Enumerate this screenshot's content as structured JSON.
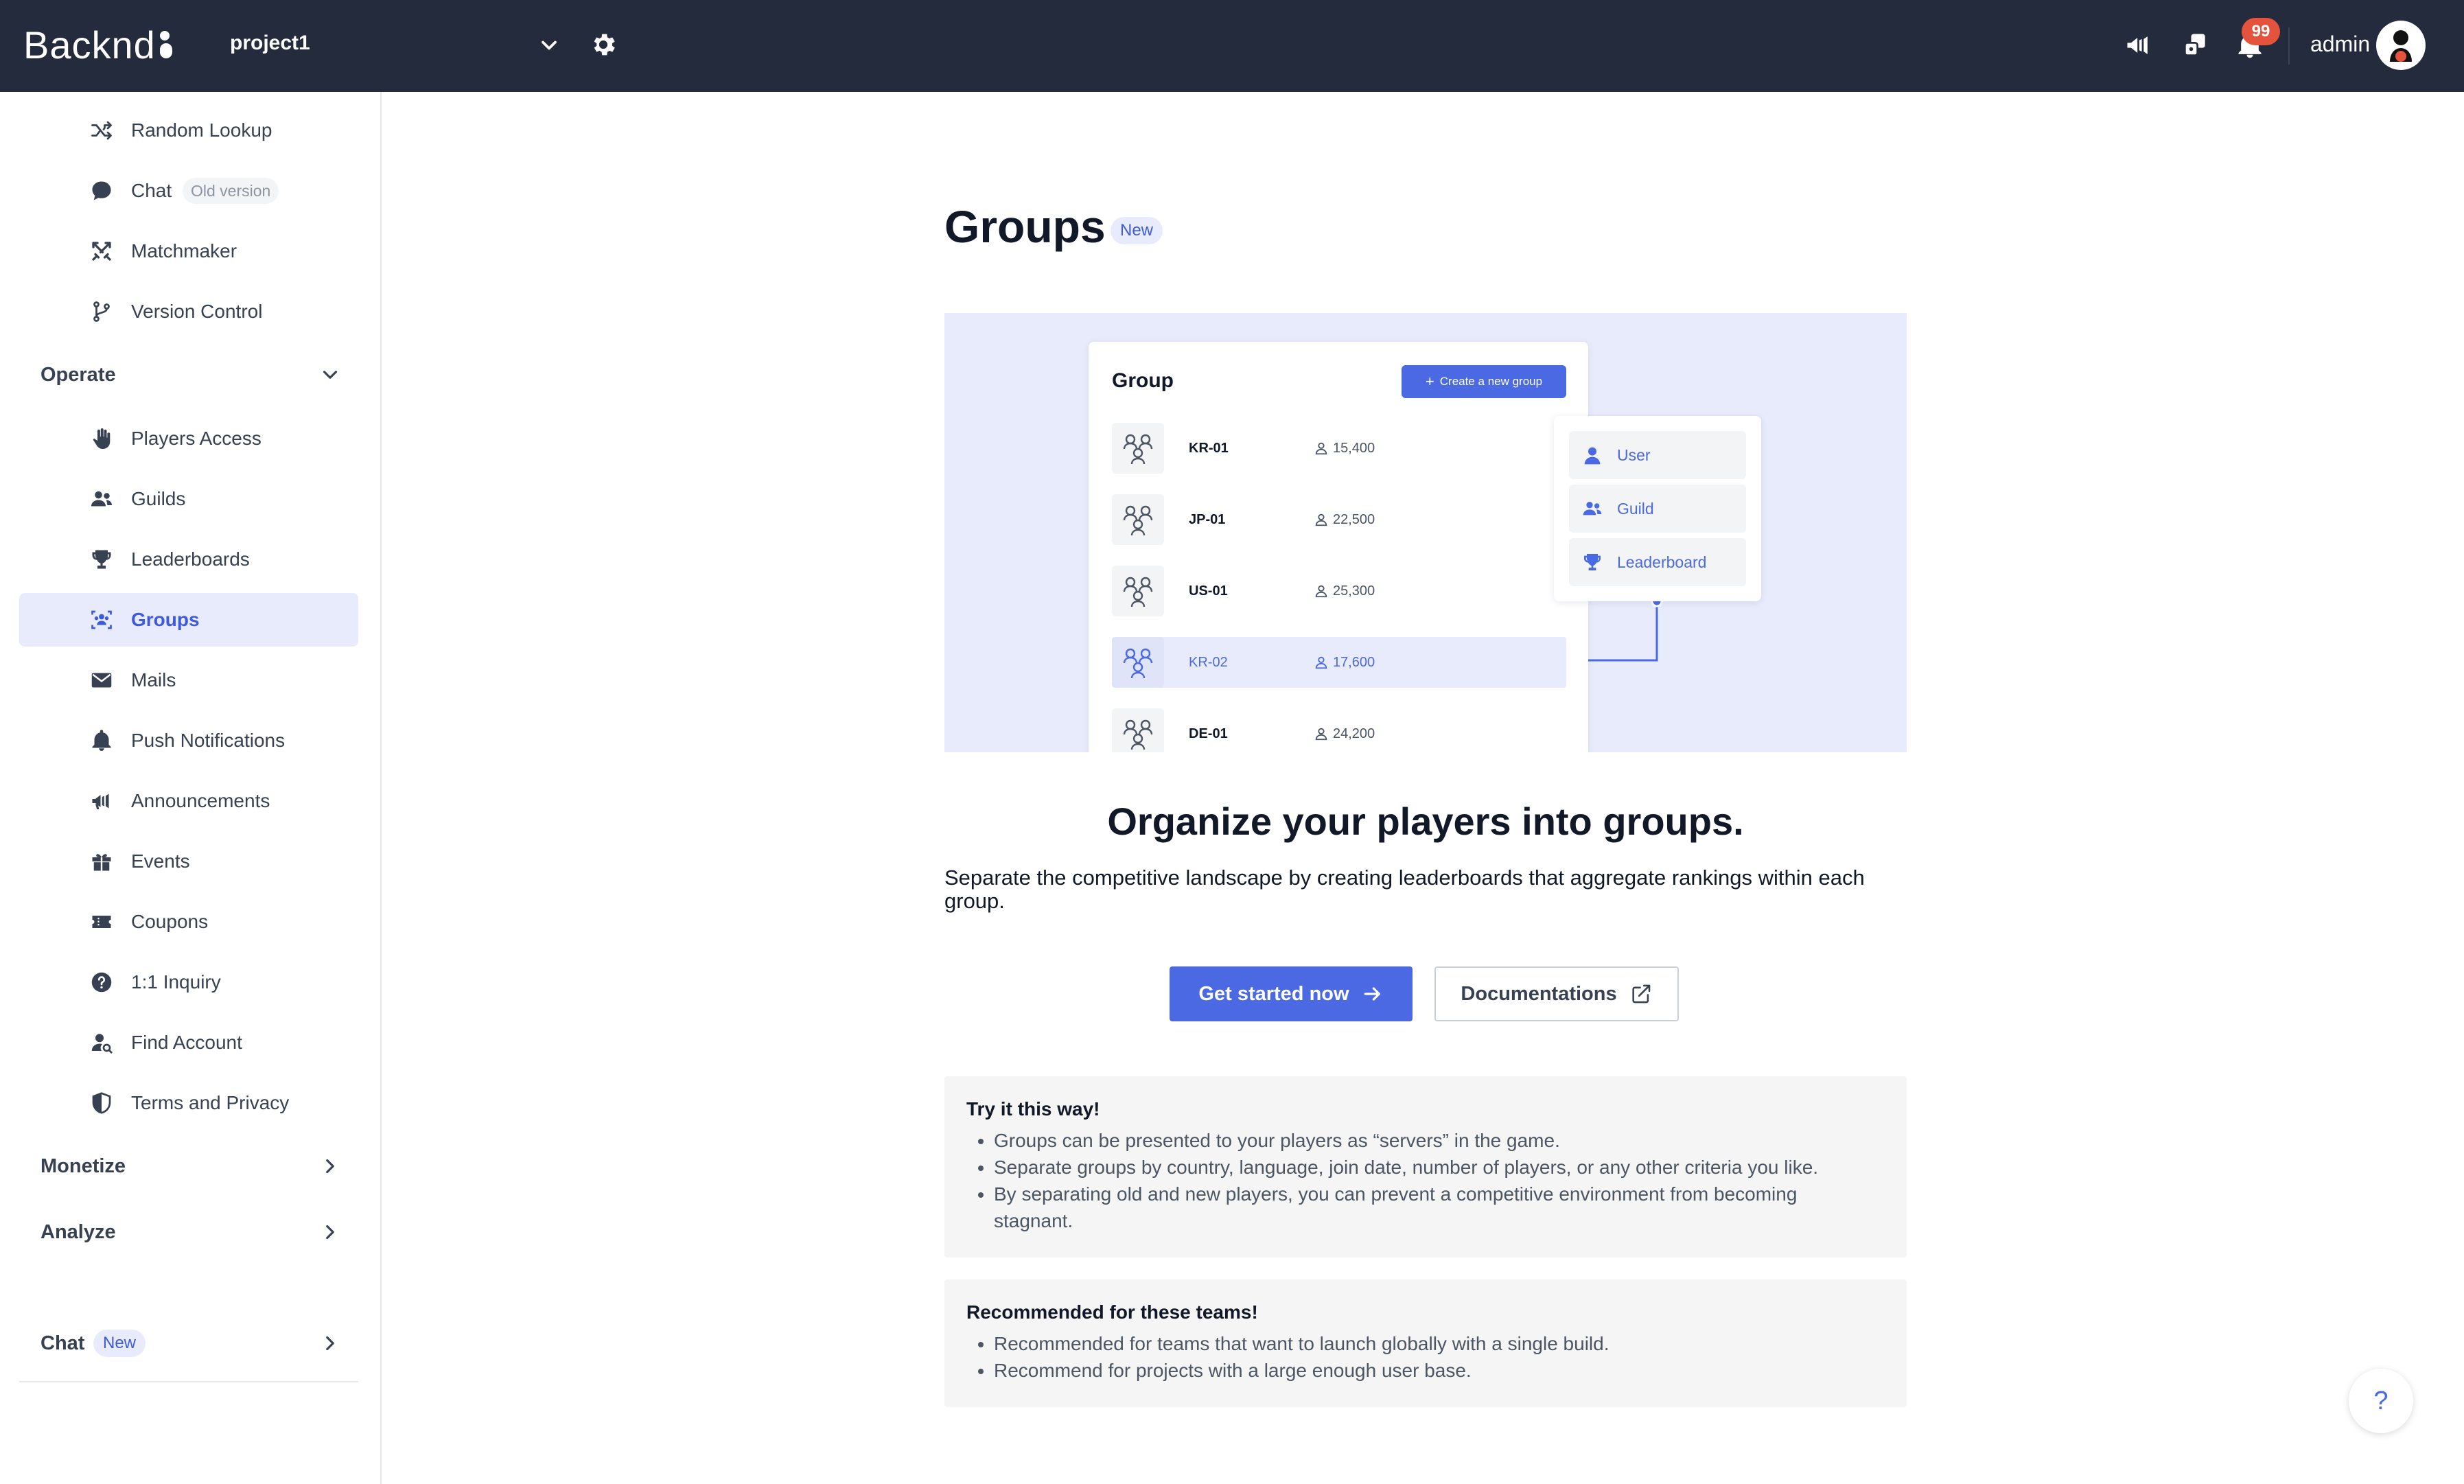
{
  "topbar": {
    "logo_text": "Backnd",
    "project_name": "project1",
    "badge_count": "99",
    "admin_name": "admin"
  },
  "sidebar": {
    "items_top": [
      {
        "label": "Random Lookup",
        "icon": "shuffle-icon"
      },
      {
        "label": "Chat",
        "icon": "chat-icon",
        "tag": "Old version"
      },
      {
        "label": "Matchmaker",
        "icon": "swords-icon"
      },
      {
        "label": "Version Control",
        "icon": "branch-icon"
      }
    ],
    "operate_label": "Operate",
    "operate_items": [
      {
        "label": "Players Access",
        "icon": "hand-icon"
      },
      {
        "label": "Guilds",
        "icon": "users-icon"
      },
      {
        "label": "Leaderboards",
        "icon": "trophy-icon"
      },
      {
        "label": "Groups",
        "icon": "group-icon",
        "active": true
      },
      {
        "label": "Mails",
        "icon": "mail-icon"
      },
      {
        "label": "Push Notifications",
        "icon": "bell-icon"
      },
      {
        "label": "Announcements",
        "icon": "megaphone-icon"
      },
      {
        "label": "Events",
        "icon": "gift-icon"
      },
      {
        "label": "Coupons",
        "icon": "ticket-icon"
      },
      {
        "label": "1:1 Inquiry",
        "icon": "question-icon"
      },
      {
        "label": "Find Account",
        "icon": "user-search-icon"
      },
      {
        "label": "Terms and Privacy",
        "icon": "shield-icon"
      }
    ],
    "monetize_label": "Monetize",
    "analyze_label": "Analyze",
    "chat_label": "Chat",
    "chat_tag": "New"
  },
  "main": {
    "title": "Groups",
    "title_tag": "New",
    "illustration": {
      "card_title": "Group",
      "create_button": "Create a new group",
      "groups": [
        {
          "code": "KR-01",
          "count": "15,400",
          "selected": false
        },
        {
          "code": "JP-01",
          "count": "22,500",
          "selected": false
        },
        {
          "code": "US-01",
          "count": "25,300",
          "selected": false
        },
        {
          "code": "KR-02",
          "count": "17,600",
          "selected": true
        },
        {
          "code": "DE-01",
          "count": "24,200",
          "selected": false
        }
      ],
      "menu": [
        {
          "label": "User",
          "icon": "user-icon"
        },
        {
          "label": "Guild",
          "icon": "users-icon"
        },
        {
          "label": "Leaderboard",
          "icon": "trophy-icon"
        }
      ]
    },
    "headline": "Organize your players into groups.",
    "description": "Separate the competitive landscape by creating leaderboards that aggregate rankings within each group.",
    "primary_button": "Get started now",
    "secondary_button": "Documentations",
    "tips": {
      "title": "Try it this way!",
      "items": [
        "Groups can be presented to your players as “servers” in the game.",
        "Separate groups by country, language, join date, number of players, or any other criteria you like.",
        "By separating old and new players, you can prevent a competitive environment from becoming stagnant."
      ]
    },
    "recommend": {
      "title": "Recommended for these teams!",
      "items": [
        "Recommended for teams that want to launch globally with a single build.",
        "Recommend for projects with a large enough user base."
      ]
    },
    "help_label": "?"
  },
  "colors": {
    "topbar": "#232b3c",
    "accent": "#4a69e2",
    "active_bg": "#e8ebfb",
    "badge": "#e5533d"
  }
}
